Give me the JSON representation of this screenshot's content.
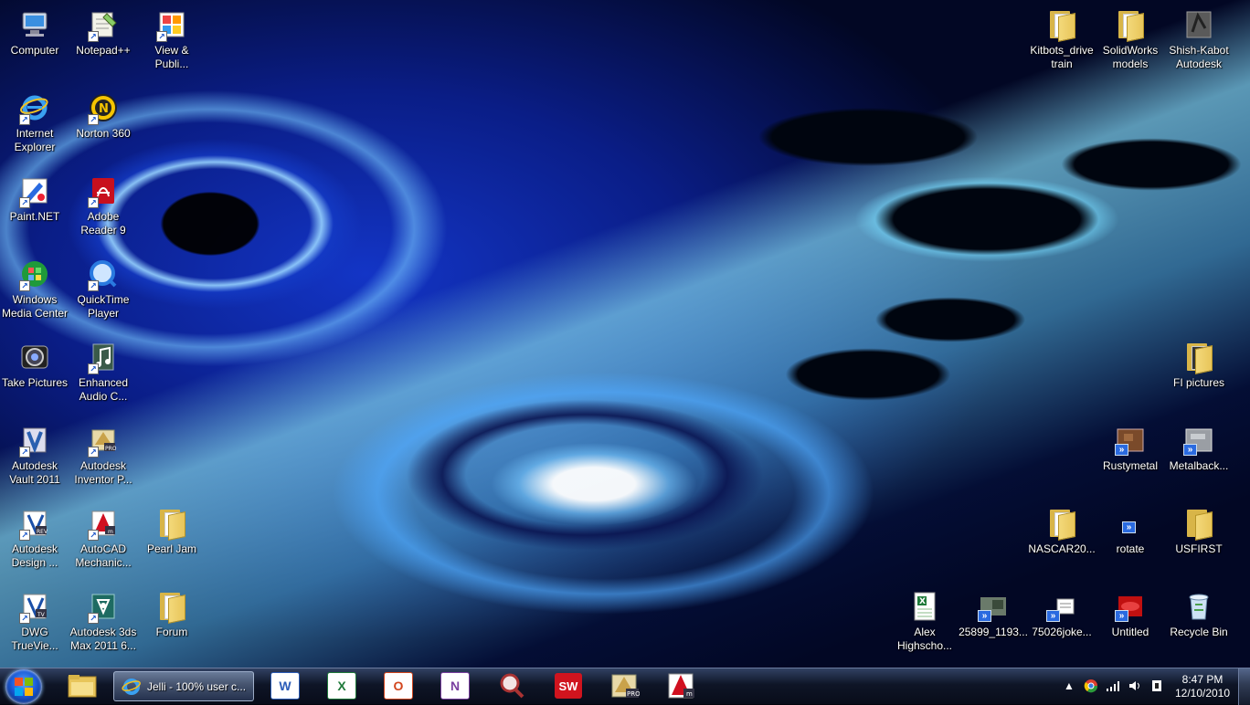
{
  "desktop": {
    "icons": [
      {
        "label": "Computer",
        "icon": "computer-icon"
      },
      {
        "label": "Notepad++",
        "icon": "notepad-plus-plus-icon"
      },
      {
        "label": "View &\nPubli...",
        "icon": "view-publish-icon"
      },
      {
        "label": "Internet\nExplorer",
        "icon": "internet-explorer-icon"
      },
      {
        "label": "Norton 360",
        "icon": "norton-360-icon"
      },
      {
        "label": "Paint.NET",
        "icon": "paint-net-icon"
      },
      {
        "label": "Adobe\nReader 9",
        "icon": "adobe-reader-icon"
      },
      {
        "label": "Windows\nMedia Center",
        "icon": "windows-media-center-icon"
      },
      {
        "label": "QuickTime\nPlayer",
        "icon": "quicktime-icon"
      },
      {
        "label": "Take Pictures",
        "icon": "camera-icon"
      },
      {
        "label": "Enhanced\nAudio C...",
        "icon": "audio-icon"
      },
      {
        "label": "Autodesk\nVault 2011",
        "icon": "autodesk-vault-icon"
      },
      {
        "label": "Autodesk\nInventor P...",
        "icon": "autodesk-inventor-icon"
      },
      {
        "label": "Autodesk\nDesign ...",
        "icon": "autodesk-revit-icon"
      },
      {
        "label": "AutoCAD\nMechanic...",
        "icon": "autocad-icon"
      },
      {
        "label": "Pearl Jam",
        "icon": "folder-icon"
      },
      {
        "label": "DWG\nTrueVie...",
        "icon": "dwg-trueview-icon"
      },
      {
        "label": "Autodesk 3ds\nMax 2011 6...",
        "icon": "3ds-max-icon"
      },
      {
        "label": "Forum",
        "icon": "folder-icon"
      },
      {
        "label": "Kitbots_drive\ntrain",
        "icon": "folder-icon"
      },
      {
        "label": "SolidWorks\nmodels",
        "icon": "folder-icon"
      },
      {
        "label": "Shish-Kabot\nAutodesk",
        "icon": "folder-dark-icon"
      },
      {
        "label": "FI pictures",
        "icon": "folder-icon"
      },
      {
        "label": "Rustymetal",
        "icon": "image-shortcut-icon"
      },
      {
        "label": "Metalback...",
        "icon": "image-shortcut-icon"
      },
      {
        "label": "NASCAR20...",
        "icon": "folder-icon"
      },
      {
        "label": "rotate",
        "icon": "shortcut-icon"
      },
      {
        "label": "USFIRST",
        "icon": "folder-icon"
      },
      {
        "label": "Alex\nHighscho...",
        "icon": "excel-file-icon"
      },
      {
        "label": "25899_1193...",
        "icon": "image-shortcut-icon"
      },
      {
        "label": "75026joke...",
        "icon": "image-shortcut-icon"
      },
      {
        "label": "Untitled",
        "icon": "image-shortcut-icon"
      },
      {
        "label": "Recycle Bin",
        "icon": "recycle-bin-icon"
      }
    ]
  },
  "taskbar": {
    "active_window_title": "Jelli - 100% user c...",
    "pinned": [
      "explorer",
      "word",
      "excel",
      "outlook",
      "onenote",
      "search-tool",
      "solidworks",
      "inventor",
      "autocad"
    ],
    "clock": {
      "time": "8:47 PM",
      "date": "12/10/2010"
    },
    "colors": {
      "accent": "#1a5bd8",
      "word": "#2b5cb8",
      "excel": "#1f7a3a",
      "outlook": "#d2461e",
      "onenote": "#7a3fa0",
      "solidworks": "#d0141e"
    }
  }
}
